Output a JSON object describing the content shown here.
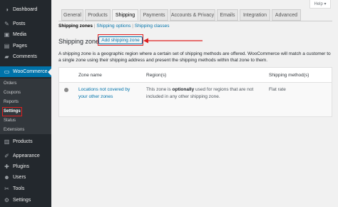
{
  "sidebar": {
    "items": [
      {
        "label": "Dashboard",
        "icon": "dashboard-icon",
        "glyph": "◑"
      },
      {
        "label": "Posts",
        "icon": "pin-icon",
        "glyph": "✎"
      },
      {
        "label": "Media",
        "icon": "media-icon",
        "glyph": "▣"
      },
      {
        "label": "Pages",
        "icon": "page-icon",
        "glyph": "▤"
      },
      {
        "label": "Comments",
        "icon": "comment-icon",
        "glyph": "▰"
      },
      {
        "label": "WooCommerce",
        "icon": "woocommerce-icon",
        "glyph": "▭"
      },
      {
        "label": "Products",
        "icon": "products-icon",
        "glyph": "▥"
      },
      {
        "label": "Appearance",
        "icon": "appearance-icon",
        "glyph": "✐"
      },
      {
        "label": "Plugins",
        "icon": "plugin-icon",
        "glyph": "✚"
      },
      {
        "label": "Users",
        "icon": "users-icon",
        "glyph": "☻"
      },
      {
        "label": "Tools",
        "icon": "tools-icon",
        "glyph": "✂"
      },
      {
        "label": "Settings",
        "icon": "settings-icon",
        "glyph": "⚙"
      }
    ],
    "submenu": [
      "Orders",
      "Coupons",
      "Reports",
      "Settings",
      "Status",
      "Extensions"
    ]
  },
  "help_label": "Help ▾",
  "tabs": [
    "General",
    "Products",
    "Shipping",
    "Payments",
    "Accounts & Privacy",
    "Emails",
    "Integration",
    "Advanced"
  ],
  "subnav": {
    "current": "Shipping zones",
    "links": [
      "Shipping options",
      "Shipping classes"
    ],
    "separator": " | "
  },
  "heading": {
    "title": "Shipping zones",
    "add_button": "Add shipping zone"
  },
  "description": "A shipping zone is a geographic region where a certain set of shipping methods are offered. WooCommerce will match a customer to a single zone using their shipping address and present the shipping methods within that zone to them.",
  "table": {
    "headers": [
      "Zone name",
      "Region(s)",
      "Shipping method(s)"
    ],
    "row": {
      "name": "Locations not covered by your other zones",
      "region_before": "This zone is ",
      "region_bold": "optionally",
      "region_after": " used for regions that are not included in any other shipping zone.",
      "method": "Flat rate"
    }
  },
  "colors": {
    "accent": "#0073aa",
    "highlight": "#e02020",
    "sidebar": "#23282d"
  }
}
